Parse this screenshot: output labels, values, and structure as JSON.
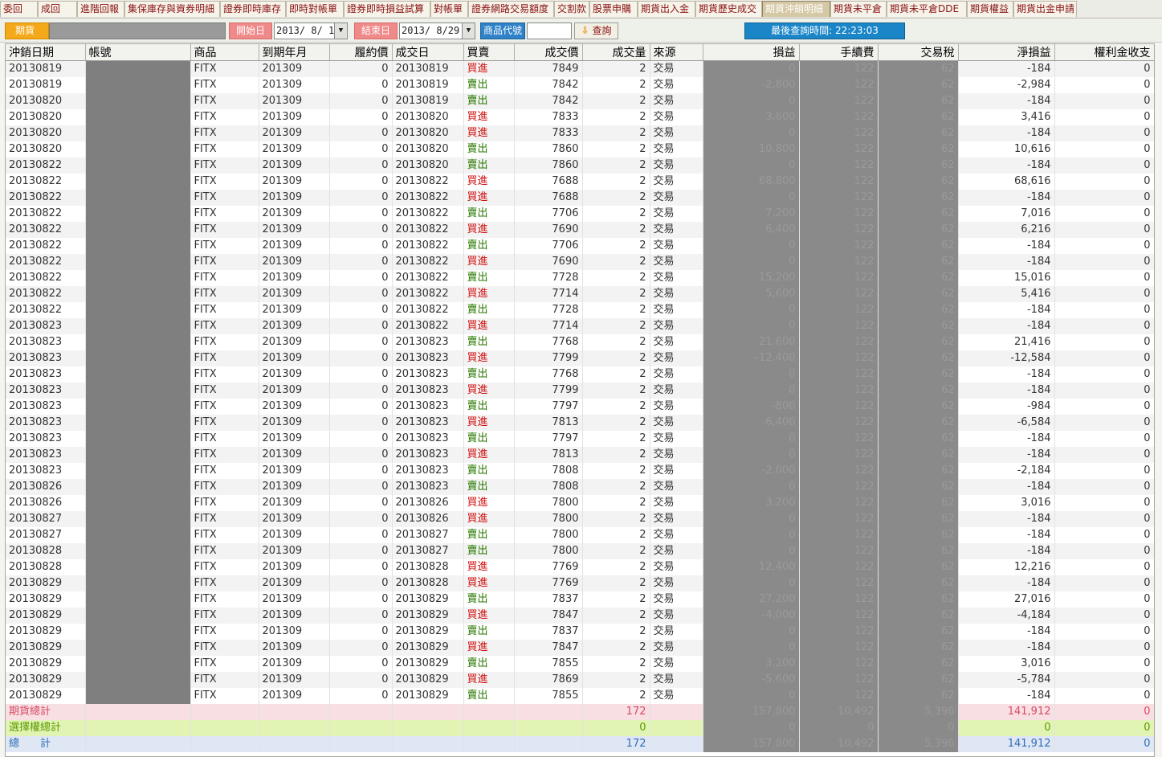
{
  "tabs": [
    {
      "label": "委回",
      "active": false
    },
    {
      "label": "成回",
      "active": false
    },
    {
      "label": "進階回報",
      "active": false
    },
    {
      "label": "集保庫存與資券明細",
      "active": false
    },
    {
      "label": "證券即時庫存",
      "active": false
    },
    {
      "label": "即時對帳單",
      "active": false
    },
    {
      "label": "證券即時損益試算",
      "active": false
    },
    {
      "label": "對帳單",
      "active": false
    },
    {
      "label": "證券網路交易額度",
      "active": false
    },
    {
      "label": "交割款",
      "active": false
    },
    {
      "label": "股票申購",
      "active": false
    },
    {
      "label": "期貨出入金",
      "active": false
    },
    {
      "label": "期貨歷史成交",
      "active": false
    },
    {
      "label": "期貨沖銷明細",
      "active": true
    },
    {
      "label": "期貨未平倉",
      "active": false
    },
    {
      "label": "期貨未平倉DDE",
      "active": false
    },
    {
      "label": "期貨權益",
      "active": false
    },
    {
      "label": "期貨出金申請",
      "active": false
    }
  ],
  "filter": {
    "futures_label": "期貨",
    "start_label": "開始日",
    "start_date": "2013/ 8/ 1",
    "end_label": "結束日",
    "end_date": "2013/ 8/29",
    "code_label": "商品代號",
    "code_value": "",
    "query_label": "查詢",
    "query_arrow": "⇩",
    "dropdown_glyph": "▼",
    "last_query_text": "最後查詢時間: 22:23:03"
  },
  "table": {
    "headers": [
      "沖銷日期",
      "帳號",
      "商品",
      "到期年月",
      "履約價",
      "成交日",
      "買賣",
      "成交價",
      "成交量",
      "來源",
      "損益",
      "手續費",
      "交易稅",
      "淨損益",
      "權利金收支"
    ],
    "rows": [
      [
        "20130819",
        "",
        "FITX",
        "201309",
        "0",
        "20130819",
        "買進",
        "7849",
        "2",
        "交易",
        "0",
        "122",
        "62",
        "-184",
        "0"
      ],
      [
        "20130819",
        "",
        "FITX",
        "201309",
        "0",
        "20130819",
        "賣出",
        "7842",
        "2",
        "交易",
        "-2,800",
        "122",
        "62",
        "-2,984",
        "0"
      ],
      [
        "20130820",
        "",
        "FITX",
        "201309",
        "0",
        "20130819",
        "賣出",
        "7842",
        "2",
        "交易",
        "0",
        "122",
        "62",
        "-184",
        "0"
      ],
      [
        "20130820",
        "",
        "FITX",
        "201309",
        "0",
        "20130820",
        "買進",
        "7833",
        "2",
        "交易",
        "3,600",
        "122",
        "62",
        "3,416",
        "0"
      ],
      [
        "20130820",
        "",
        "FITX",
        "201309",
        "0",
        "20130820",
        "買進",
        "7833",
        "2",
        "交易",
        "0",
        "122",
        "62",
        "-184",
        "0"
      ],
      [
        "20130820",
        "",
        "FITX",
        "201309",
        "0",
        "20130820",
        "賣出",
        "7860",
        "2",
        "交易",
        "10,800",
        "122",
        "62",
        "10,616",
        "0"
      ],
      [
        "20130822",
        "",
        "FITX",
        "201309",
        "0",
        "20130820",
        "賣出",
        "7860",
        "2",
        "交易",
        "0",
        "122",
        "62",
        "-184",
        "0"
      ],
      [
        "20130822",
        "",
        "FITX",
        "201309",
        "0",
        "20130822",
        "買進",
        "7688",
        "2",
        "交易",
        "68,800",
        "122",
        "62",
        "68,616",
        "0"
      ],
      [
        "20130822",
        "",
        "FITX",
        "201309",
        "0",
        "20130822",
        "買進",
        "7688",
        "2",
        "交易",
        "0",
        "122",
        "62",
        "-184",
        "0"
      ],
      [
        "20130822",
        "",
        "FITX",
        "201309",
        "0",
        "20130822",
        "賣出",
        "7706",
        "2",
        "交易",
        "7,200",
        "122",
        "62",
        "7,016",
        "0"
      ],
      [
        "20130822",
        "",
        "FITX",
        "201309",
        "0",
        "20130822",
        "買進",
        "7690",
        "2",
        "交易",
        "6,400",
        "122",
        "62",
        "6,216",
        "0"
      ],
      [
        "20130822",
        "",
        "FITX",
        "201309",
        "0",
        "20130822",
        "賣出",
        "7706",
        "2",
        "交易",
        "0",
        "122",
        "62",
        "-184",
        "0"
      ],
      [
        "20130822",
        "",
        "FITX",
        "201309",
        "0",
        "20130822",
        "買進",
        "7690",
        "2",
        "交易",
        "0",
        "122",
        "62",
        "-184",
        "0"
      ],
      [
        "20130822",
        "",
        "FITX",
        "201309",
        "0",
        "20130822",
        "賣出",
        "7728",
        "2",
        "交易",
        "15,200",
        "122",
        "62",
        "15,016",
        "0"
      ],
      [
        "20130822",
        "",
        "FITX",
        "201309",
        "0",
        "20130822",
        "買進",
        "7714",
        "2",
        "交易",
        "5,600",
        "122",
        "62",
        "5,416",
        "0"
      ],
      [
        "20130822",
        "",
        "FITX",
        "201309",
        "0",
        "20130822",
        "賣出",
        "7728",
        "2",
        "交易",
        "0",
        "122",
        "62",
        "-184",
        "0"
      ],
      [
        "20130823",
        "",
        "FITX",
        "201309",
        "0",
        "20130822",
        "買進",
        "7714",
        "2",
        "交易",
        "0",
        "122",
        "62",
        "-184",
        "0"
      ],
      [
        "20130823",
        "",
        "FITX",
        "201309",
        "0",
        "20130823",
        "賣出",
        "7768",
        "2",
        "交易",
        "21,600",
        "122",
        "62",
        "21,416",
        "0"
      ],
      [
        "20130823",
        "",
        "FITX",
        "201309",
        "0",
        "20130823",
        "買進",
        "7799",
        "2",
        "交易",
        "-12,400",
        "122",
        "62",
        "-12,584",
        "0"
      ],
      [
        "20130823",
        "",
        "FITX",
        "201309",
        "0",
        "20130823",
        "賣出",
        "7768",
        "2",
        "交易",
        "0",
        "122",
        "62",
        "-184",
        "0"
      ],
      [
        "20130823",
        "",
        "FITX",
        "201309",
        "0",
        "20130823",
        "買進",
        "7799",
        "2",
        "交易",
        "0",
        "122",
        "62",
        "-184",
        "0"
      ],
      [
        "20130823",
        "",
        "FITX",
        "201309",
        "0",
        "20130823",
        "賣出",
        "7797",
        "2",
        "交易",
        "-800",
        "122",
        "62",
        "-984",
        "0"
      ],
      [
        "20130823",
        "",
        "FITX",
        "201309",
        "0",
        "20130823",
        "買進",
        "7813",
        "2",
        "交易",
        "-6,400",
        "122",
        "62",
        "-6,584",
        "0"
      ],
      [
        "20130823",
        "",
        "FITX",
        "201309",
        "0",
        "20130823",
        "賣出",
        "7797",
        "2",
        "交易",
        "0",
        "122",
        "62",
        "-184",
        "0"
      ],
      [
        "20130823",
        "",
        "FITX",
        "201309",
        "0",
        "20130823",
        "買進",
        "7813",
        "2",
        "交易",
        "0",
        "122",
        "62",
        "-184",
        "0"
      ],
      [
        "20130823",
        "",
        "FITX",
        "201309",
        "0",
        "20130823",
        "賣出",
        "7808",
        "2",
        "交易",
        "-2,000",
        "122",
        "62",
        "-2,184",
        "0"
      ],
      [
        "20130826",
        "",
        "FITX",
        "201309",
        "0",
        "20130823",
        "賣出",
        "7808",
        "2",
        "交易",
        "0",
        "122",
        "62",
        "-184",
        "0"
      ],
      [
        "20130826",
        "",
        "FITX",
        "201309",
        "0",
        "20130826",
        "買進",
        "7800",
        "2",
        "交易",
        "3,200",
        "122",
        "62",
        "3,016",
        "0"
      ],
      [
        "20130827",
        "",
        "FITX",
        "201309",
        "0",
        "20130826",
        "買進",
        "7800",
        "2",
        "交易",
        "0",
        "122",
        "62",
        "-184",
        "0"
      ],
      [
        "20130827",
        "",
        "FITX",
        "201309",
        "0",
        "20130827",
        "賣出",
        "7800",
        "2",
        "交易",
        "0",
        "122",
        "62",
        "-184",
        "0"
      ],
      [
        "20130828",
        "",
        "FITX",
        "201309",
        "0",
        "20130827",
        "賣出",
        "7800",
        "2",
        "交易",
        "0",
        "122",
        "62",
        "-184",
        "0"
      ],
      [
        "20130828",
        "",
        "FITX",
        "201309",
        "0",
        "20130828",
        "買進",
        "7769",
        "2",
        "交易",
        "12,400",
        "122",
        "62",
        "12,216",
        "0"
      ],
      [
        "20130829",
        "",
        "FITX",
        "201309",
        "0",
        "20130828",
        "買進",
        "7769",
        "2",
        "交易",
        "0",
        "122",
        "62",
        "-184",
        "0"
      ],
      [
        "20130829",
        "",
        "FITX",
        "201309",
        "0",
        "20130829",
        "賣出",
        "7837",
        "2",
        "交易",
        "27,200",
        "122",
        "62",
        "27,016",
        "0"
      ],
      [
        "20130829",
        "",
        "FITX",
        "201309",
        "0",
        "20130829",
        "買進",
        "7847",
        "2",
        "交易",
        "-4,000",
        "122",
        "62",
        "-4,184",
        "0"
      ],
      [
        "20130829",
        "",
        "FITX",
        "201309",
        "0",
        "20130829",
        "賣出",
        "7837",
        "2",
        "交易",
        "0",
        "122",
        "62",
        "-184",
        "0"
      ],
      [
        "20130829",
        "",
        "FITX",
        "201309",
        "0",
        "20130829",
        "買進",
        "7847",
        "2",
        "交易",
        "0",
        "122",
        "62",
        "-184",
        "0"
      ],
      [
        "20130829",
        "",
        "FITX",
        "201309",
        "0",
        "20130829",
        "賣出",
        "7855",
        "2",
        "交易",
        "3,200",
        "122",
        "62",
        "3,016",
        "0"
      ],
      [
        "20130829",
        "",
        "FITX",
        "201309",
        "0",
        "20130829",
        "買進",
        "7869",
        "2",
        "交易",
        "-5,600",
        "122",
        "62",
        "-5,784",
        "0"
      ],
      [
        "20130829",
        "",
        "FITX",
        "201309",
        "0",
        "20130829",
        "賣出",
        "7855",
        "2",
        "交易",
        "0",
        "122",
        "62",
        "-184",
        "0"
      ]
    ],
    "summary": [
      {
        "label": "期貨總計",
        "volume": "172",
        "pnl": "157,800",
        "fee": "10,492",
        "tax": "5,396",
        "net": "141,912",
        "premium": "0"
      },
      {
        "label": "選擇權總計",
        "volume": "0",
        "pnl": "0",
        "fee": "0",
        "tax": "0",
        "net": "0",
        "premium": "0"
      },
      {
        "label": "總　　計",
        "volume": "172",
        "pnl": "157,800",
        "fee": "10,492",
        "tax": "5,396",
        "net": "141,912",
        "premium": "0"
      }
    ]
  },
  "colors": {
    "buy": "#d01010",
    "sell": "#2a7a00",
    "futures_total": "#d94b63",
    "options_total": "#5d9a00",
    "grand_total": "#2f6fb8"
  }
}
